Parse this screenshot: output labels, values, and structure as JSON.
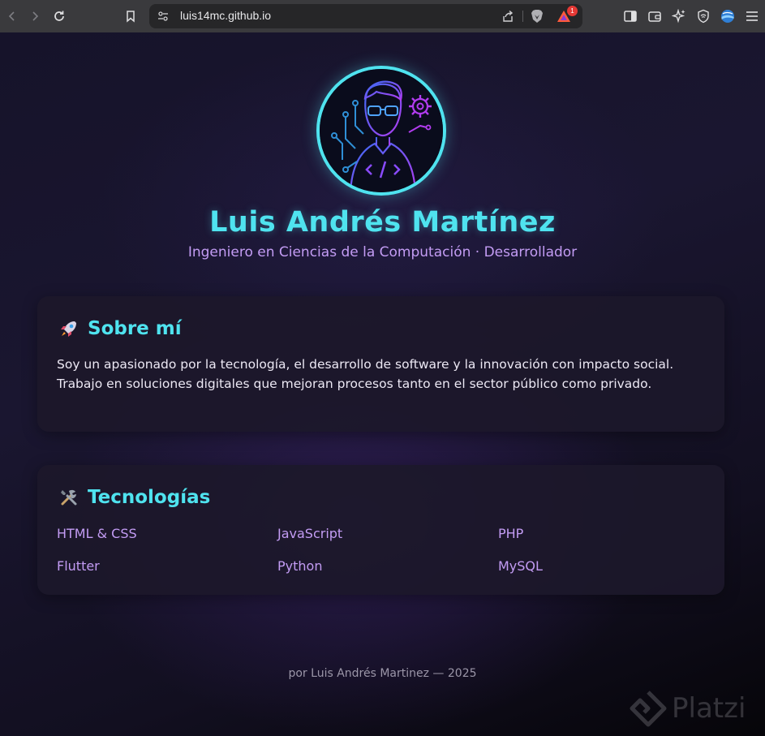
{
  "browser": {
    "url": "luis14mc.github.io",
    "notification_count": "1"
  },
  "profile": {
    "name": "Luis Andrés Martínez",
    "subtitle": "Ingeniero en Ciencias de la Computación · Desarrollador"
  },
  "about": {
    "icon": "rocket-icon",
    "title": "Sobre mí",
    "text": "Soy un apasionado por la tecnología, el desarrollo de software y la innovación con impacto social. Trabajo en soluciones digitales que mejoran procesos tanto en el sector público como privado."
  },
  "tech": {
    "icon": "tools-icon",
    "title": "Tecnologías",
    "items": [
      "HTML & CSS",
      "JavaScript",
      "PHP",
      "Flutter",
      "Python",
      "MySQL"
    ]
  },
  "footer": {
    "text": "por Luis Andrés Martinez — 2025"
  },
  "watermark": {
    "text": "Platzi"
  },
  "colors": {
    "accent_cyan": "#4fe3ef",
    "accent_purple": "#c39cf4",
    "card_bg": "#1c182a"
  }
}
